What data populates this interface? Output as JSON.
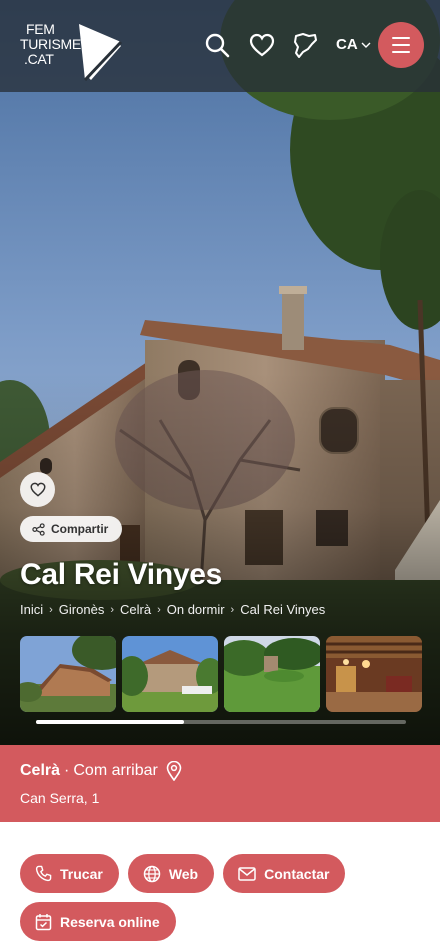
{
  "header": {
    "logo_lines": [
      "FEM",
      "TURISME",
      ".CAT"
    ],
    "language": "CA",
    "icons": [
      "search-icon",
      "heart-icon",
      "catalonia-map-icon",
      "chevron-down-icon",
      "hamburger-menu-icon"
    ]
  },
  "hero": {
    "title": "Cal Rei Vinyes",
    "share_label": "Compartir",
    "breadcrumb": [
      "Inici",
      "Gironès",
      "Celrà",
      "On dormir",
      "Cal Rei Vinyes"
    ],
    "gallery_count_visible": 4,
    "gallery_scroll_fraction": 0.4
  },
  "location": {
    "town": "Celrà",
    "separator": "·",
    "directions_label": "Com arribar",
    "address": "Can Serra, 1"
  },
  "actions": [
    {
      "label": "Trucar",
      "icon": "phone-icon"
    },
    {
      "label": "Web",
      "icon": "globe-icon"
    },
    {
      "label": "Contactar",
      "icon": "envelope-icon"
    },
    {
      "label": "Reserva online",
      "icon": "calendar-icon"
    }
  ],
  "colors": {
    "accent": "#d35a5e",
    "topbar": "#283038"
  }
}
